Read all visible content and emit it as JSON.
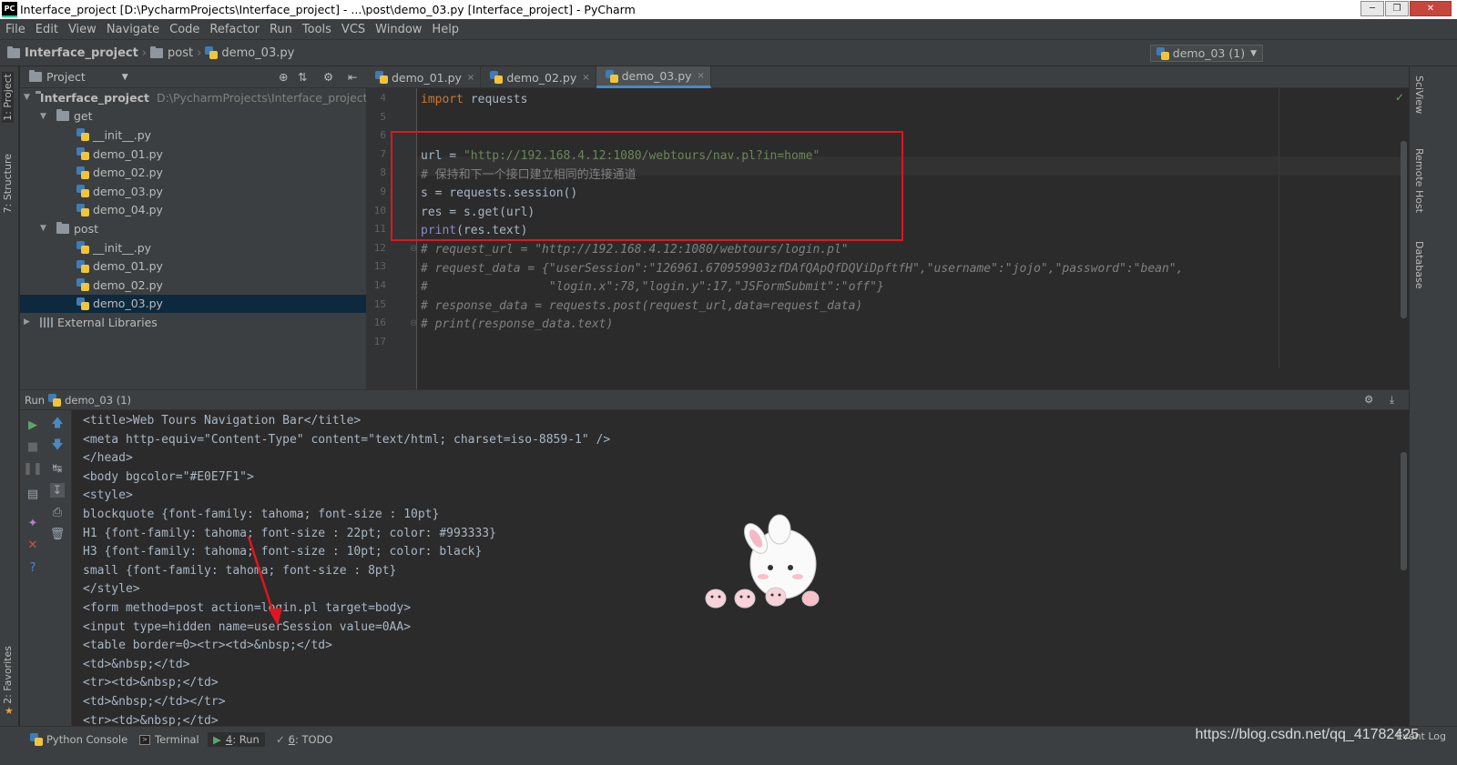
{
  "window": {
    "title": "Interface_project [D:\\PycharmProjects\\Interface_project] - ...\\post\\demo_03.py [Interface_project] - PyCharm",
    "app_badge": "PC"
  },
  "menu": [
    "File",
    "Edit",
    "View",
    "Navigate",
    "Code",
    "Refactor",
    "Run",
    "Tools",
    "VCS",
    "Window",
    "Help"
  ],
  "breadcrumb": {
    "project": "Interface_project",
    "folder": "post",
    "file": "demo_03.py"
  },
  "run_config": {
    "label": "demo_03 (1)"
  },
  "side_tabs": {
    "project": "1: Project",
    "structure": "7: Structure",
    "favorites": "2: Favorites"
  },
  "right_tabs": {
    "sciview": "SciView",
    "remote": "Remote Host",
    "database": "Database"
  },
  "project_panel": {
    "title": "Project",
    "root": {
      "name": "Interface_project",
      "path": "D:\\PycharmProjects\\Interface_project"
    },
    "get_folder": "get",
    "get_files": [
      "__init__.py",
      "demo_01.py",
      "demo_02.py",
      "demo_03.py",
      "demo_04.py"
    ],
    "post_folder": "post",
    "post_files": [
      "__init__.py",
      "demo_01.py",
      "demo_02.py",
      "demo_03.py"
    ],
    "external": "External Libraries"
  },
  "editor_tabs": [
    {
      "label": "demo_01.py",
      "close": "×"
    },
    {
      "label": "demo_02.py",
      "close": "×"
    },
    {
      "label": "demo_03.py",
      "close": "×"
    }
  ],
  "code": {
    "line_numbers": [
      "4",
      "5",
      "6",
      "7",
      "8",
      "9",
      "10",
      "11",
      "12",
      "13",
      "14",
      "15",
      "16",
      "17"
    ],
    "l4_kw": "import",
    "l4_rest": " requests",
    "l7_a": "url = ",
    "l7_str": "\"http://192.168.4.12:1080/webtours/nav.pl?in=home\"",
    "l8": "# 保持和下一个接口建立相同的连接通道",
    "l9": "s = requests.session()",
    "l10": "res = s.get(url)",
    "l11_fn": "print",
    "l11_rest": "(res.text)",
    "l12": "# request_url = \"http://192.168.4.12:1080/webtours/login.pl\"",
    "l13": "# request_data = {\"userSession\":\"126961.670959903zfDAfQApQfDQViDpftfH\",\"username\":\"jojo\",\"password\":\"bean\",",
    "l14": "#                 \"login.x\":78,\"login.y\":17,\"JSFormSubmit\":\"off\"}",
    "l15": "# response_data = requests.post(request_url,data=request_data)",
    "l16": "# print(response_data.text)"
  },
  "run_panel": {
    "label": "Run",
    "config": "demo_03 (1)",
    "output": [
      "<title>Web Tours Navigation Bar</title>",
      "<meta http-equiv=\"Content-Type\" content=\"text/html; charset=iso-8859-1\" />",
      "</head>",
      "<body bgcolor=\"#E0E7F1\">",
      "<style>",
      "blockquote {font-family: tahoma; font-size : 10pt}",
      "H1 {font-family: tahoma; font-size : 22pt; color: #993333}",
      "H3 {font-family: tahoma; font-size : 10pt; color: black}",
      "small {font-family: tahoma; font-size : 8pt}",
      "</style>",
      "<form method=post action=login.pl target=body>",
      "<input type=hidden name=userSession value=0AA>",
      "<table border=0><tr><td>&nbsp;</td>",
      "<td>&nbsp;</td>",
      "<tr><td>&nbsp;</td>",
      "<td>&nbsp;</td></tr>",
      "<tr><td>&nbsp;</td>"
    ]
  },
  "status_tools": {
    "python_console": "Python Console",
    "terminal": "Terminal",
    "run_num": "4",
    "run": ": Run",
    "todo_num": "6",
    "todo": ": TODO"
  },
  "watermark": "https://blog.csdn.net/qq_41782425",
  "event_log": "Event Log",
  "colors": {
    "accent": "#4a88c7",
    "highlight_box": "#e0161e",
    "keyword": "#cc7832",
    "string": "#6a8759",
    "comment": "#808080"
  }
}
